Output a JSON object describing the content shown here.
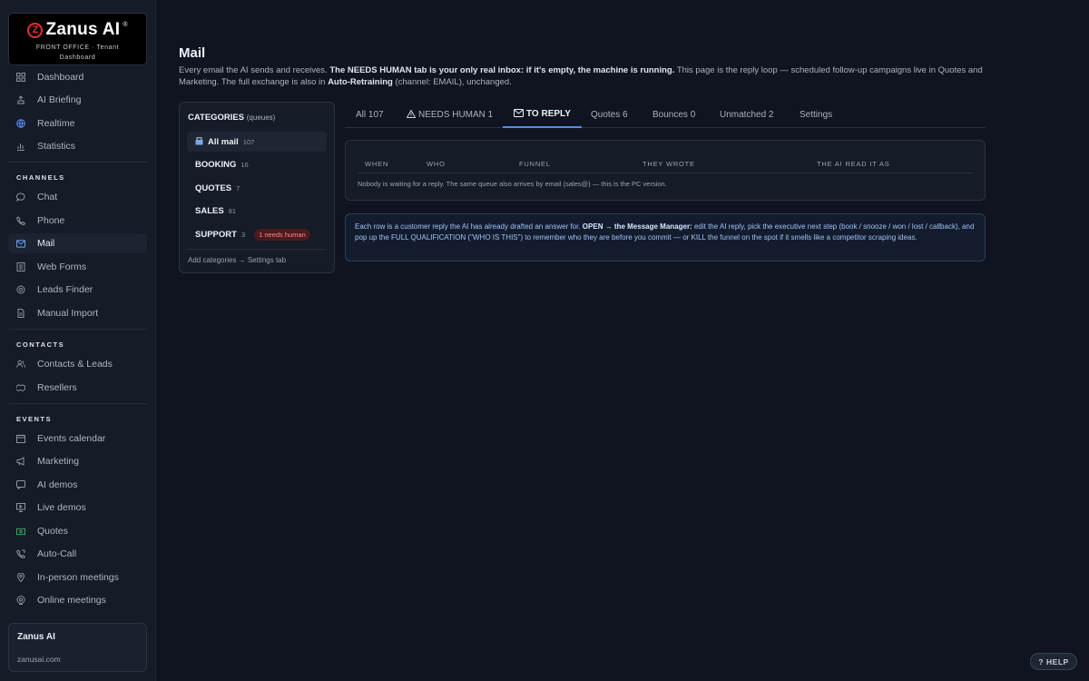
{
  "brand": {
    "logo_letter": "Z",
    "name": "Zanus AI",
    "trademark": "®",
    "sub_line1": "FRONT OFFICE · Tenant",
    "sub_line2": "Dashboard"
  },
  "sidebar": {
    "top_items": [
      {
        "label": "Dashboard",
        "icon": "grid-icon"
      },
      {
        "label": "AI Briefing",
        "icon": "briefing-icon"
      },
      {
        "label": "Realtime",
        "icon": "globe-icon"
      },
      {
        "label": "Statistics",
        "icon": "bar-chart-icon"
      }
    ],
    "channels_label": "CHANNELS",
    "channels": [
      {
        "label": "Chat",
        "icon": "chat-icon"
      },
      {
        "label": "Phone",
        "icon": "phone-icon"
      },
      {
        "label": "Mail",
        "icon": "mail-icon",
        "active": true
      },
      {
        "label": "Web Forms",
        "icon": "form-icon"
      },
      {
        "label": "Leads Finder",
        "icon": "leads-icon"
      },
      {
        "label": "Manual Import",
        "icon": "import-icon"
      }
    ],
    "contacts_label": "CONTACTS",
    "contacts": [
      {
        "label": "Contacts & Leads",
        "icon": "contacts-icon"
      },
      {
        "label": "Resellers",
        "icon": "handshake-icon"
      }
    ],
    "events_label": "EVENTS",
    "events": [
      {
        "label": "Events calendar",
        "icon": "calendar-icon"
      },
      {
        "label": "Marketing",
        "icon": "megaphone-icon"
      },
      {
        "label": "AI demos",
        "icon": "chat-bubble-icon"
      },
      {
        "label": "Live demos",
        "icon": "monitor-icon"
      },
      {
        "label": "Quotes",
        "icon": "quote-icon"
      },
      {
        "label": "Auto-Call",
        "icon": "auto-call-icon"
      },
      {
        "label": "In-person meetings",
        "icon": "location-icon"
      },
      {
        "label": "Online meetings",
        "icon": "online-icon"
      }
    ],
    "account": {
      "name": "Zanus AI",
      "domain": "zanusai.com"
    }
  },
  "main": {
    "title": "Mail",
    "intro_part1": "Every email the AI sends and receives. ",
    "intro_bold1": "The NEEDS HUMAN tab is your only real inbox: if it's empty, the machine is running.",
    "intro_part2": " This page is the reply loop — scheduled follow-up campaigns live in Quotes and Marketing. The full exchange is also in ",
    "intro_bold2": "Auto-Retraining",
    "intro_part3": " (channel: EMAIL), unchanged."
  },
  "categories": {
    "title": "CATEGORIES",
    "title_sub": "(queues)",
    "items": [
      {
        "label": "All mail",
        "count": "107",
        "active": true
      },
      {
        "label": "BOOKING",
        "count": "16"
      },
      {
        "label": "QUOTES",
        "count": "7"
      },
      {
        "label": "SALES",
        "count": "81"
      },
      {
        "label": "SUPPORT",
        "count": "3",
        "badge": "1 needs human"
      }
    ],
    "footer": "Add categories → Settings tab"
  },
  "tabs": [
    {
      "label": "All 107"
    },
    {
      "label": "NEEDS HUMAN 1",
      "icon": "warning-icon"
    },
    {
      "label": "TO REPLY",
      "icon": "mail-icon",
      "active": true
    },
    {
      "label": "Quotes 6"
    },
    {
      "label": "Bounces 0"
    },
    {
      "label": "Unmatched 2"
    },
    {
      "label": "Settings"
    }
  ],
  "table": {
    "columns": [
      "WHEN",
      "WHO",
      "FUNNEL",
      "THEY WROTE",
      "THE AI READ IT AS"
    ],
    "empty_message": "Nobody is waiting for a reply. The same queue also arrives by email (sales@) — this is the PC version."
  },
  "info": {
    "part1": "Each row is a customer reply the AI has already drafted an answer for. ",
    "bold1": "OPEN → the Message Manager:",
    "part2": " edit the AI reply, pick the executive next step (book / snooze / won / lost / callback), and pop up the FULL QUALIFICATION (\"WHO IS THIS\") to remember who they are before you commit — or KILL the funnel on the spot if it smells like a competitor scraping ideas."
  },
  "help": {
    "icon": "?",
    "label": "HELP"
  },
  "colors": {
    "accent": "#4d8ff0",
    "brand_red": "#e0312e",
    "badge_red": "#ff8a8a",
    "background": "#0f1420"
  }
}
